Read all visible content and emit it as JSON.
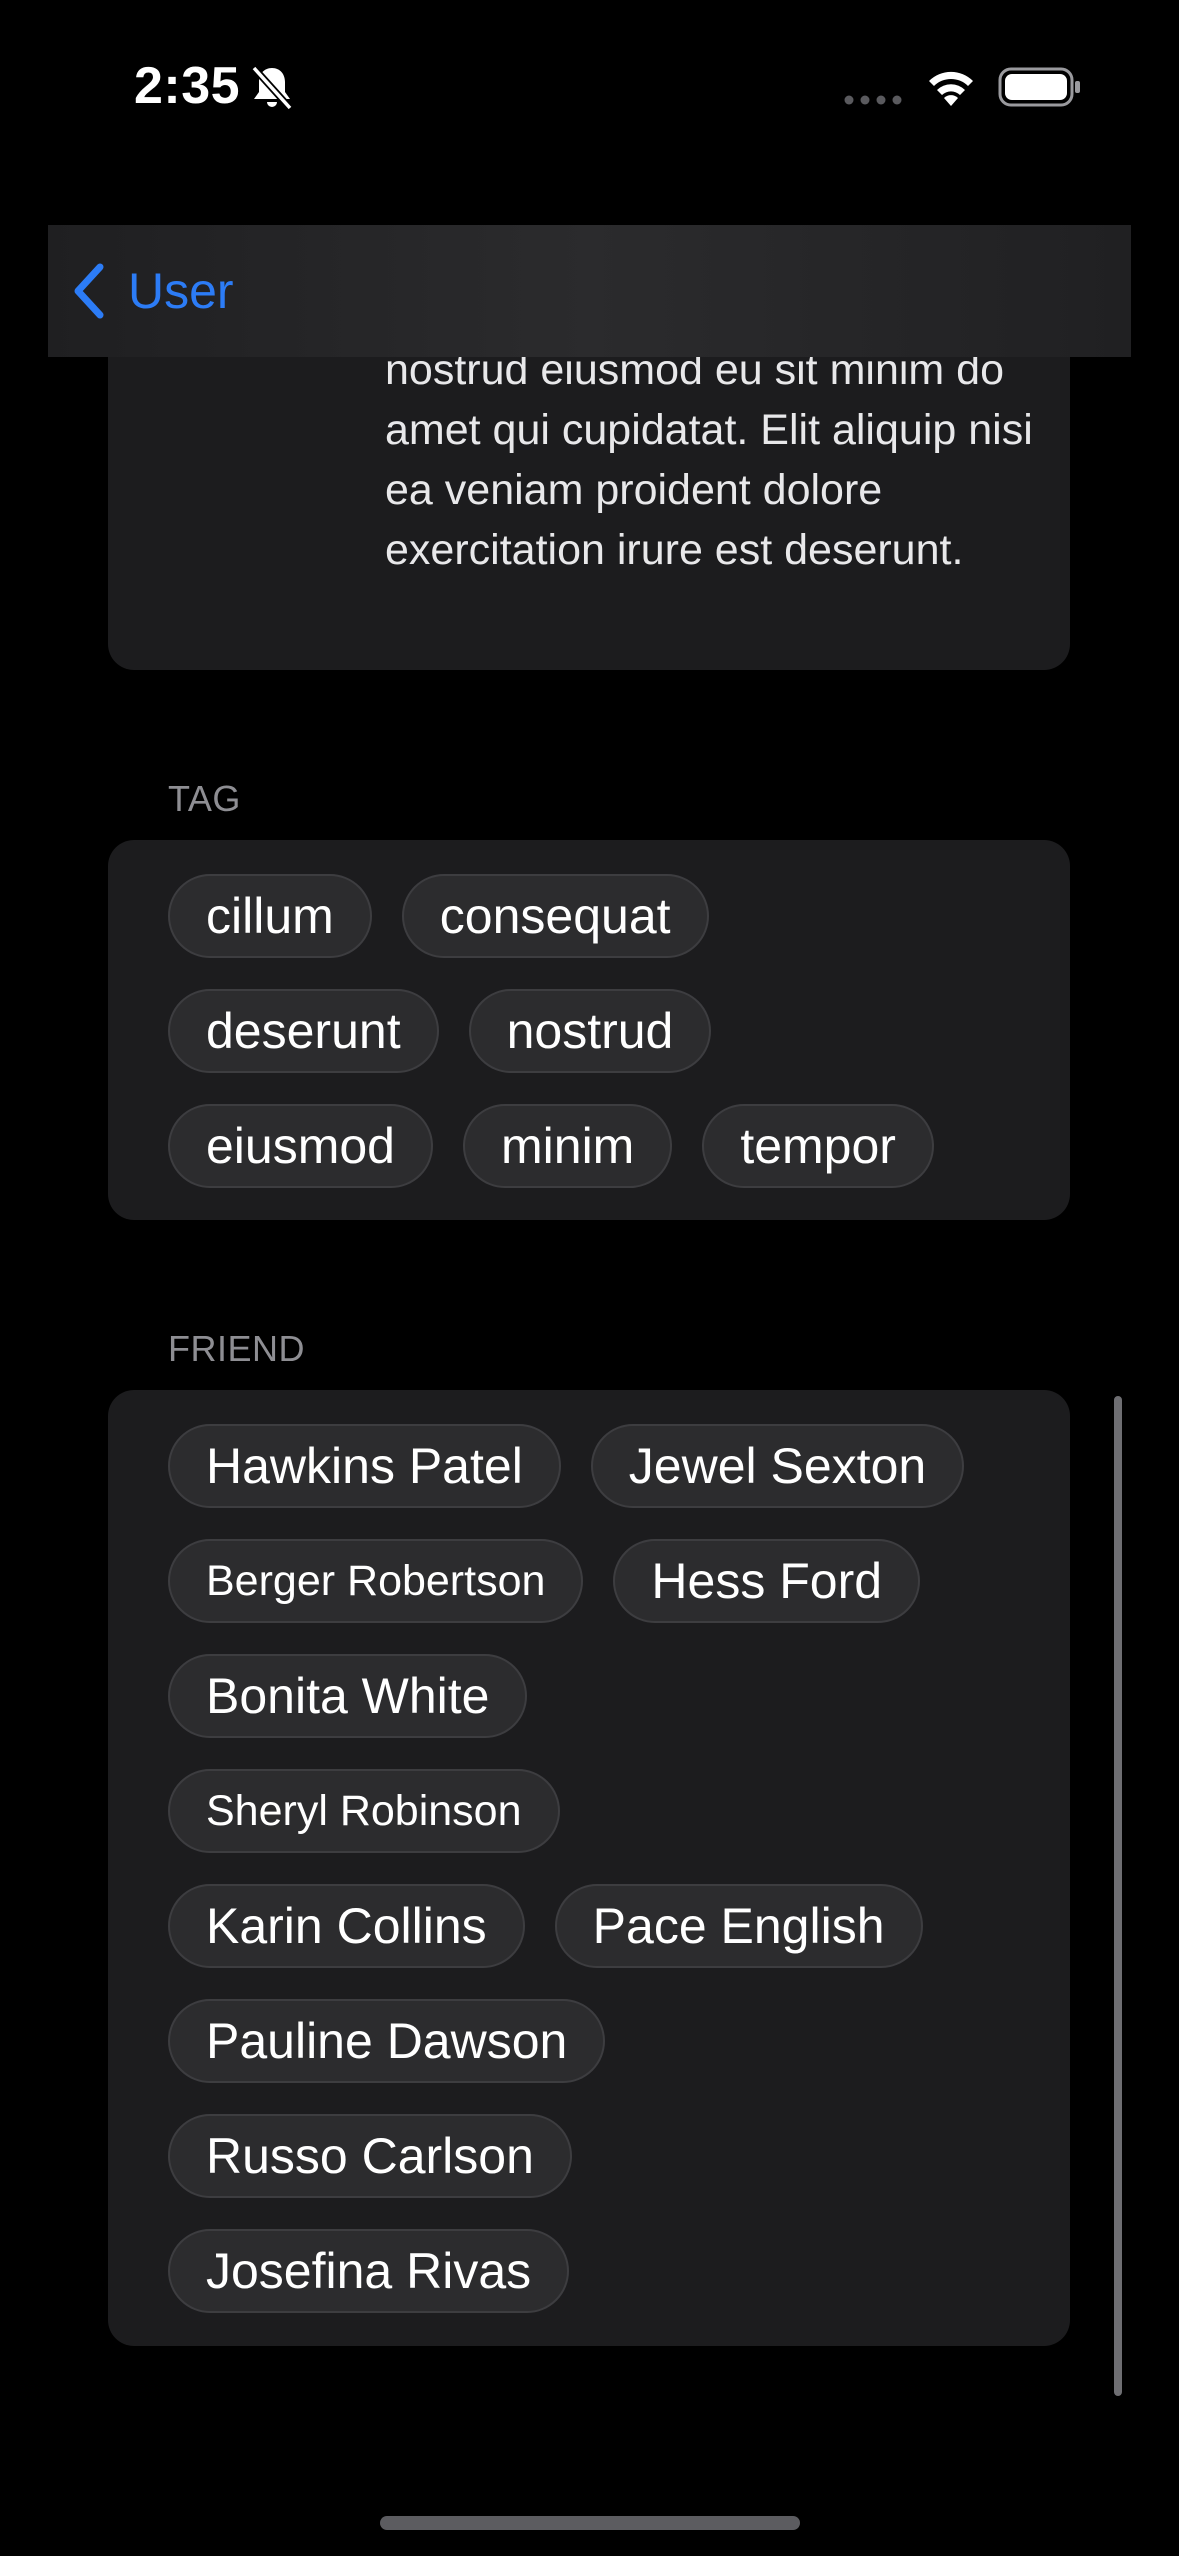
{
  "status_bar": {
    "time": "2:35",
    "icons": [
      "bell-slash-icon",
      "signal-icon",
      "wifi-icon",
      "battery-icon"
    ]
  },
  "nav": {
    "back_label": "User",
    "back_icon": "chevron-left-icon",
    "accent_color": "#2c7cf6"
  },
  "about": {
    "text": "nostrud eiusmod eu sit minim do amet qui cupidatat. Elit aliquip nisi ea veniam proident dolore exercitation irure est deserunt."
  },
  "tag_section": {
    "header": "TAG",
    "tags": [
      "cillum",
      "consequat",
      "deserunt",
      "nostrud",
      "eiusmod",
      "minim",
      "tempor"
    ]
  },
  "friend_section": {
    "header": "FRIEND",
    "friends": [
      "Hawkins Patel",
      "Jewel Sexton",
      "Berger Robertson",
      "Hess Ford",
      "Bonita White",
      "Sheryl Robinson",
      "Karin Collins",
      "Pace English",
      "Pauline Dawson",
      "Russo Carlson",
      "Josefina Rivas"
    ]
  }
}
